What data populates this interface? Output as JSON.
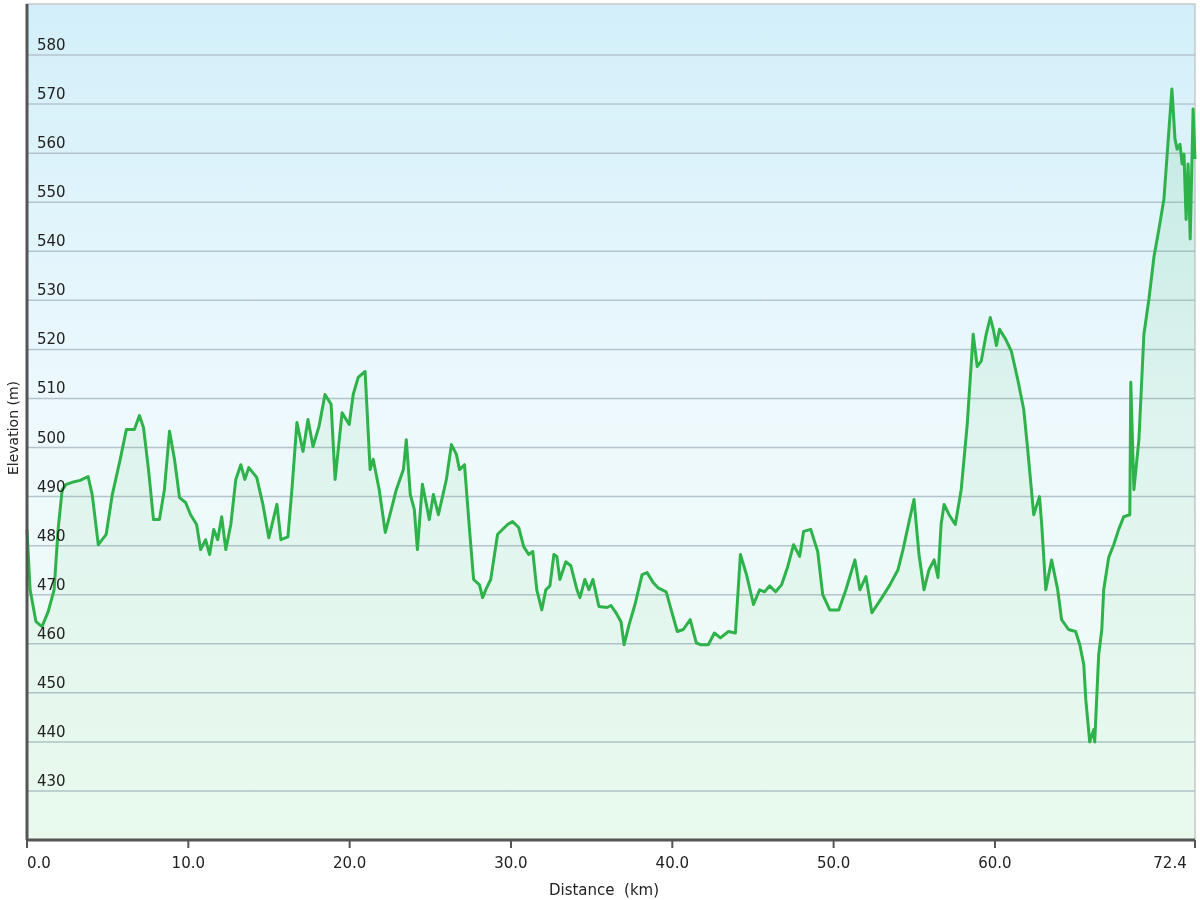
{
  "chart": {
    "chart_data": {
      "type": "area",
      "xlabel": "Distance  (km)",
      "ylabel": "Elevation (m)",
      "xlim": [
        0,
        72.4
      ],
      "ylim": [
        420,
        590.4
      ],
      "xticks": [
        {
          "value": 0,
          "label": "0.0"
        },
        {
          "value": 10,
          "label": "10.0"
        },
        {
          "value": 20,
          "label": "20.0"
        },
        {
          "value": 30,
          "label": "30.0"
        },
        {
          "value": 40,
          "label": "40.0"
        },
        {
          "value": 50,
          "label": "50.0"
        },
        {
          "value": 60,
          "label": "60.0"
        },
        {
          "value": 72.4,
          "label": "72.4"
        }
      ],
      "grid": true,
      "yticks": [
        430,
        440,
        450,
        460,
        470,
        480,
        490,
        500,
        510,
        520,
        530,
        540,
        550,
        560,
        570,
        580
      ],
      "x": [
        0.0,
        0.19,
        0.56,
        0.93,
        1.31,
        1.68,
        1.93,
        2.18,
        2.43,
        2.8,
        3.3,
        3.79,
        4.04,
        4.42,
        4.91,
        5.29,
        5.78,
        6.16,
        6.66,
        6.97,
        7.22,
        7.53,
        7.84,
        8.21,
        8.52,
        8.83,
        9.14,
        9.45,
        9.83,
        10.14,
        10.51,
        10.76,
        11.07,
        11.32,
        11.57,
        11.82,
        12.07,
        12.32,
        12.63,
        12.94,
        13.25,
        13.5,
        13.75,
        14.24,
        14.62,
        14.99,
        15.49,
        15.74,
        16.17,
        16.42,
        16.73,
        17.11,
        17.42,
        17.73,
        18.1,
        18.47,
        18.85,
        19.1,
        19.53,
        19.97,
        20.22,
        20.53,
        20.96,
        21.27,
        21.46,
        21.83,
        22.21,
        22.58,
        22.89,
        23.33,
        23.51,
        23.76,
        24.01,
        24.2,
        24.51,
        24.76,
        24.94,
        25.19,
        25.5,
        26.0,
        26.31,
        26.62,
        26.81,
        27.12,
        27.43,
        27.68,
        28.05,
        28.24,
        28.49,
        28.74,
        29.17,
        29.79,
        30.1,
        30.48,
        30.79,
        31.1,
        31.35,
        31.6,
        31.91,
        32.16,
        32.41,
        32.66,
        32.84,
        33.03,
        33.4,
        33.71,
        34.09,
        34.27,
        34.58,
        34.83,
        35.08,
        35.45,
        35.95,
        36.2,
        36.51,
        36.82,
        37.01,
        37.32,
        37.69,
        38.13,
        38.44,
        38.81,
        39.12,
        39.62,
        39.93,
        40.31,
        40.68,
        41.11,
        41.49,
        41.74,
        42.23,
        42.61,
        42.98,
        43.48,
        43.91,
        44.22,
        44.6,
        45.03,
        45.41,
        45.72,
        46.03,
        46.4,
        46.77,
        47.15,
        47.52,
        47.89,
        48.14,
        48.58,
        49.01,
        49.32,
        49.76,
        50.32,
        50.76,
        51.32,
        51.63,
        52.0,
        52.37,
        52.99,
        53.49,
        53.99,
        54.3,
        54.6,
        54.98,
        55.29,
        55.6,
        55.91,
        56.23,
        56.47,
        56.66,
        56.85,
        57.16,
        57.54,
        57.91,
        58.28,
        58.65,
        58.9,
        59.15,
        59.46,
        59.71,
        59.9,
        60.09,
        60.28,
        60.66,
        61.02,
        61.41,
        61.78,
        62.03,
        62.4,
        62.76,
        62.9,
        63.15,
        63.51,
        63.89,
        64.13,
        64.56,
        65.0,
        65.26,
        65.51,
        65.63,
        65.87,
        66.12,
        66.18,
        66.43,
        66.62,
        66.74,
        67.05,
        67.36,
        67.67,
        67.98,
        68.36,
        68.42,
        68.61,
        68.92,
        69.23,
        69.54,
        69.85,
        70.16,
        70.47,
        70.79,
        70.97,
        71.16,
        71.29,
        71.47,
        71.6,
        71.72,
        71.85,
        71.97,
        72.1,
        72.28,
        72.4
      ],
      "series": [
        {
          "color": "#2eb24a",
          "values": [
            483.3,
            471.0,
            464.5,
            463.5,
            466.5,
            471.0,
            483.3,
            491.4,
            492.5,
            492.9,
            493.3,
            494.1,
            490.4,
            480.2,
            482.3,
            490.4,
            497.6,
            503.7,
            503.7,
            506.5,
            504.1,
            495.5,
            485.3,
            485.3,
            491.4,
            503.3,
            497.6,
            489.8,
            488.8,
            486.3,
            484.3,
            479.2,
            481.2,
            478.2,
            483.3,
            481.2,
            485.9,
            479.2,
            484.3,
            493.5,
            496.5,
            493.5,
            495.9,
            493.9,
            488.4,
            481.6,
            488.4,
            481.2,
            481.8,
            491.4,
            505.1,
            499.2,
            505.7,
            500.2,
            504.3,
            510.8,
            508.8,
            493.5,
            507.1,
            504.7,
            510.8,
            514.3,
            515.5,
            495.5,
            497.6,
            491.4,
            482.7,
            487.4,
            491.4,
            495.5,
            501.6,
            490.4,
            487.4,
            479.2,
            492.5,
            488.4,
            485.3,
            490.4,
            486.3,
            493.5,
            500.6,
            498.6,
            495.5,
            496.5,
            483.3,
            473.1,
            472.0,
            469.4,
            471.4,
            473.1,
            482.3,
            484.3,
            484.9,
            483.7,
            479.8,
            478.2,
            478.8,
            471.0,
            466.9,
            471.0,
            471.8,
            478.2,
            477.8,
            473.1,
            476.7,
            475.9,
            471.0,
            469.4,
            473.1,
            471.0,
            473.1,
            467.6,
            467.4,
            467.8,
            466.3,
            464.5,
            459.8,
            463.9,
            468.0,
            474.1,
            474.5,
            472.5,
            471.4,
            470.6,
            466.9,
            462.5,
            462.9,
            464.9,
            460.2,
            459.8,
            459.8,
            462.2,
            461.2,
            462.5,
            462.2,
            478.2,
            474.1,
            468.0,
            471.0,
            470.6,
            471.8,
            470.6,
            472.0,
            475.7,
            480.2,
            477.8,
            482.9,
            483.3,
            478.8,
            470.0,
            466.9,
            466.9,
            471.0,
            477.1,
            471.0,
            473.7,
            466.3,
            469.4,
            472.0,
            475.1,
            479.2,
            483.7,
            489.4,
            478.2,
            471.0,
            475.1,
            477.1,
            473.5,
            484.3,
            488.4,
            486.3,
            484.3,
            491.4,
            504.7,
            523.1,
            516.5,
            517.6,
            523.1,
            526.5,
            524.1,
            520.8,
            524.1,
            522.1,
            519.6,
            513.9,
            507.8,
            499.6,
            486.3,
            490.0,
            484.3,
            471.0,
            477.1,
            471.0,
            464.9,
            462.9,
            462.5,
            459.8,
            455.7,
            448.6,
            440.0,
            442.5,
            440.0,
            457.8,
            462.9,
            471.0,
            477.6,
            480.2,
            483.3,
            485.9,
            486.3,
            513.3,
            491.4,
            501.6,
            523.1,
            530.2,
            538.8,
            544.5,
            550.6,
            564.9,
            573.1,
            562.9,
            560.8,
            561.8,
            557.8,
            559.8,
            546.5,
            557.8,
            542.5,
            569.0,
            558.8
          ]
        }
      ]
    }
  }
}
